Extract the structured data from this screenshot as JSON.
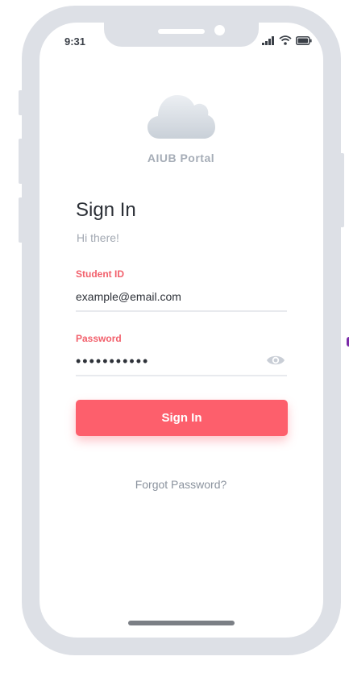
{
  "status_bar": {
    "time": "9:31",
    "icons": [
      "signal-icon",
      "wifi-icon",
      "battery-icon"
    ]
  },
  "app": {
    "logo_icon": "cloud-icon",
    "name": "AIUB Portal"
  },
  "sign_in": {
    "title": "Sign In",
    "subtitle": "Hi there!",
    "student_id_label": "Student ID",
    "student_id_value": "example@email.com",
    "password_label": "Password",
    "password_value": "•••••••••••",
    "password_toggle_icon": "eye-icon",
    "submit_label": "Sign In",
    "forgot_label": "Forgot Password?"
  },
  "colors": {
    "accent": "#fd5f6c",
    "label": "#f2606c",
    "frame": "#dde0e6"
  }
}
